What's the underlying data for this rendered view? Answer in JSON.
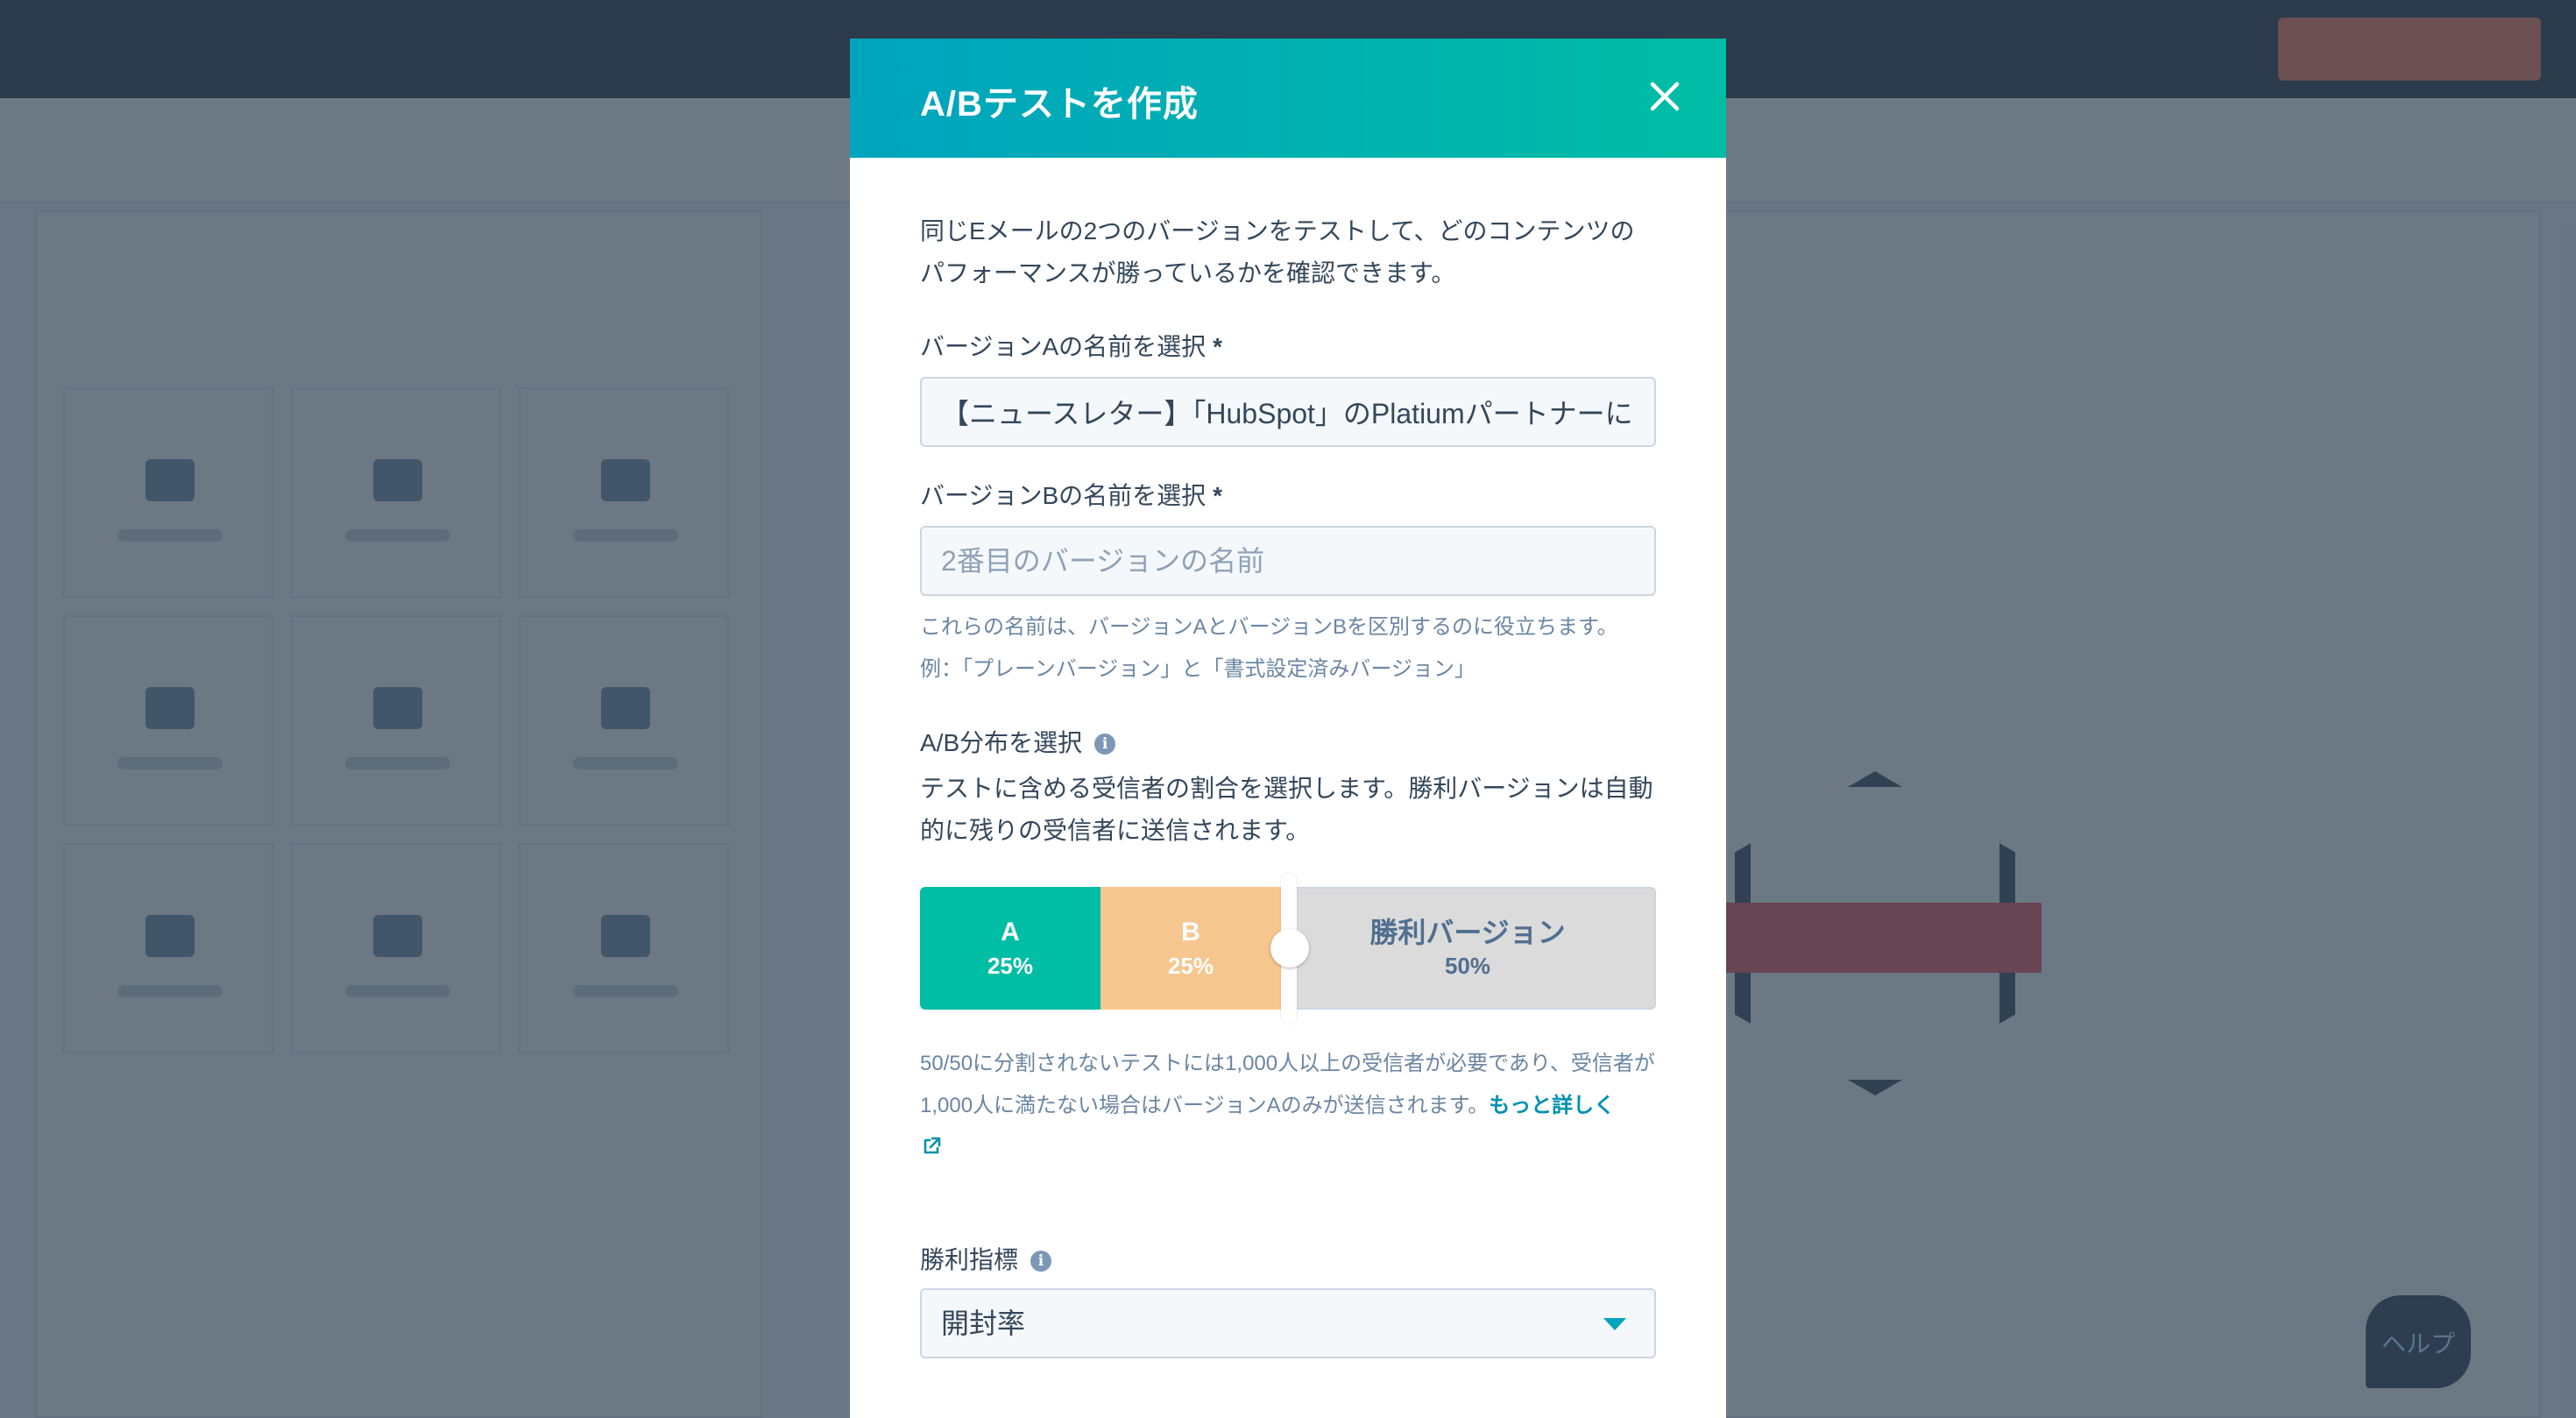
{
  "modal": {
    "title": "A/Bテストを作成",
    "intro": "同じEメールの2つのバージョンをテストして、どのコンテンツのパフォーマンスが勝っているかを確認できます。",
    "version_a": {
      "label": "バージョンAの名前を選択",
      "required_mark": "*",
      "value": "【ニュースレター】「HubSpot」のPlatiumパートナーに"
    },
    "version_b": {
      "label": "バージョンBの名前を選択",
      "required_mark": "*",
      "value": "",
      "placeholder": "2番目のバージョンの名前"
    },
    "names_help_line1": "これらの名前は、バージョンAとバージョンBを区別するのに役立ちます。",
    "names_help_line2": "例：「プレーンバージョン」と「書式設定済みバージョン」",
    "distribution": {
      "label": "A/B分布を選択",
      "description": "テストに含める受信者の割合を選択します。勝利バージョンは自動的に残りの受信者に送信されます。",
      "segments": [
        {
          "name": "A",
          "percent": "25%",
          "color": "#00bda5"
        },
        {
          "name": "B",
          "percent": "25%",
          "color": "#f5c78e"
        },
        {
          "name": "勝利バージョン",
          "percent": "50%",
          "color": "#dbdbdb"
        }
      ],
      "slider_position_percent": 50,
      "note": "50/50に分割されないテストには1,000人以上の受信者が必要であり、受信者が1,000人に満たない場合はバージョンAのみが送信されます。",
      "learn_more": "もっと詳しく"
    },
    "winning_metric": {
      "label": "勝利指標",
      "selected": "開封率"
    }
  },
  "colors": {
    "header_gradient_start": "#00a4bd",
    "header_gradient_end": "#00bda5",
    "text": "#33475b",
    "help_text": "#6a86a3",
    "link": "#0091ae"
  },
  "background": {
    "help_button": "ヘルプ"
  }
}
